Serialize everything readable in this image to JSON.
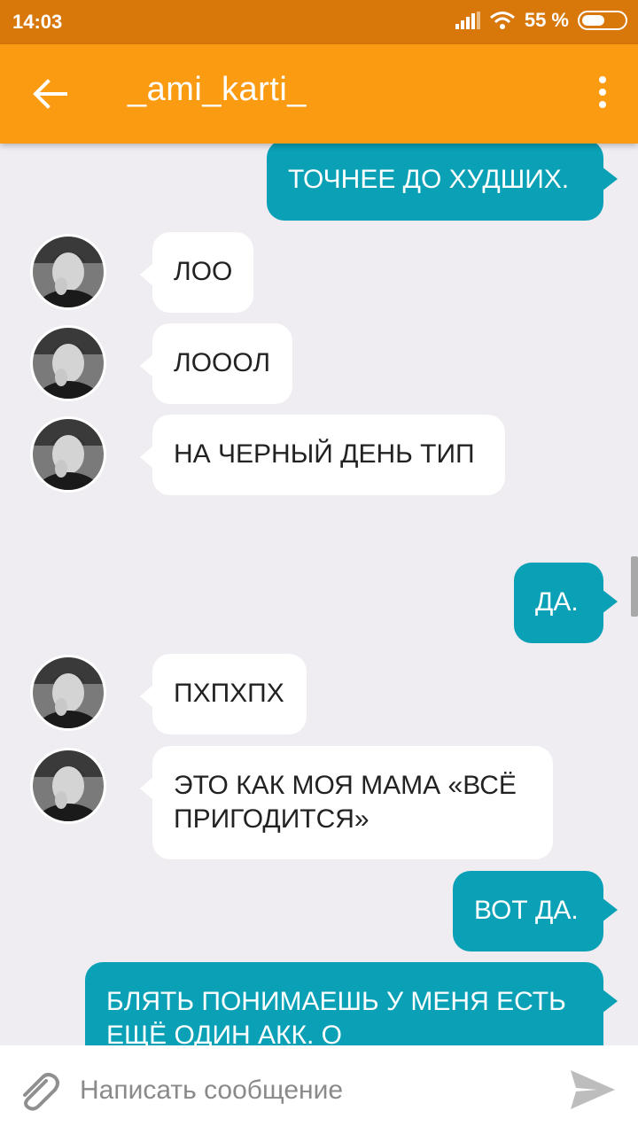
{
  "status": {
    "time": "14:03",
    "battery": "55 %",
    "battery_level": 0.55
  },
  "header": {
    "title": "_ami_karti_"
  },
  "messages": [
    {
      "dir": "out",
      "text": "ТОЧНЕЕ ДО ХУДШИХ."
    },
    {
      "dir": "in",
      "text": "ЛОО"
    },
    {
      "dir": "in",
      "text": "ЛОООЛ"
    },
    {
      "dir": "in",
      "text": "НА ЧЕРНЫЙ ДЕНЬ ТИП"
    },
    {
      "dir": "out",
      "text": "ДА."
    },
    {
      "dir": "in",
      "text": "ПХПХПХ"
    },
    {
      "dir": "in",
      "text": "ЭТО КАК МОЯ МАМА «ВСЁ ПРИГОДИТСЯ»"
    },
    {
      "dir": "out",
      "text": "ВОТ ДА."
    },
    {
      "dir": "out",
      "text": "БЛЯТЬ ПОНИМАЕШЬ У МЕНЯ ЕСТЬ ЕЩЁ ОДИН АКК. О"
    }
  ],
  "composer": {
    "placeholder": "Написать сообщение"
  },
  "icons": {
    "back": "arrow-left-icon",
    "more": "more-vertical-icon",
    "attach": "paperclip-icon",
    "send": "send-icon",
    "wifi": "wifi-icon",
    "signal": "signal-icon",
    "battery": "battery-icon"
  },
  "colors": {
    "statusbar": "#d9780a",
    "appbar": "#fb9b12",
    "outgoing": "#0aa0b6",
    "incoming": "#ffffff",
    "background": "#efedf1"
  }
}
